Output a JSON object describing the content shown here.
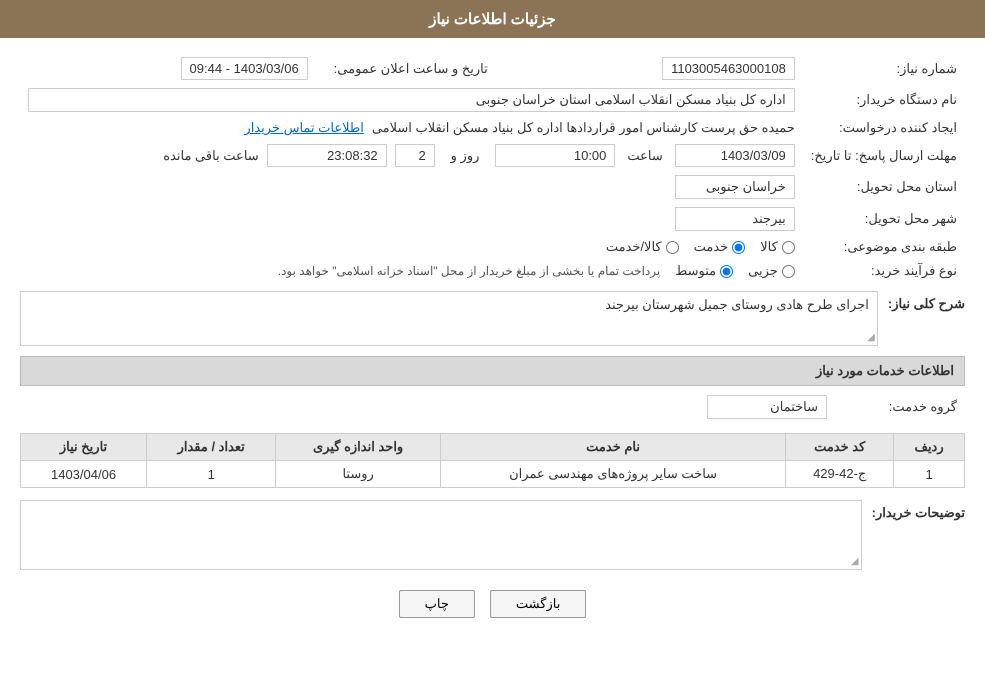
{
  "header": {
    "title": "جزئیات اطلاعات نیاز"
  },
  "fields": {
    "need_number_label": "شماره نیاز:",
    "need_number_value": "1103005463000108",
    "buyer_org_label": "نام دستگاه خریدار:",
    "buyer_org_value": "اداره کل بنیاد مسکن انقلاب اسلامی استان خراسان جنوبی",
    "creator_label": "ایجاد کننده درخواست:",
    "creator_value": "حمیده حق پرست کارشناس امور قراردادها اداره کل بنیاد مسکن انقلاب اسلامی",
    "creator_link": "اطلاعات تماس خریدار",
    "deadline_label": "مهلت ارسال پاسخ: تا تاریخ:",
    "date_announce_label": "تاریخ و ساعت اعلان عمومی:",
    "date_announce_value": "1403/03/06 - 09:44",
    "deadline_date": "1403/03/09",
    "deadline_time": "10:00",
    "deadline_days": "2",
    "deadline_time_remaining": "23:08:32",
    "province_label": "استان محل تحویل:",
    "province_value": "خراسان جنوبی",
    "city_label": "شهر محل تحویل:",
    "city_value": "بیرجند",
    "category_label": "طبقه بندی موضوعی:",
    "category_options": [
      {
        "id": "kala",
        "label": "کالا"
      },
      {
        "id": "khadamat",
        "label": "خدمت"
      },
      {
        "id": "kala_khadamat",
        "label": "کالا/خدمت"
      }
    ],
    "category_selected": "khadamat",
    "purchase_type_label": "نوع فرآیند خرید:",
    "purchase_type_options": [
      {
        "id": "jozii",
        "label": "جزیی"
      },
      {
        "id": "motavaset",
        "label": "متوسط"
      }
    ],
    "purchase_type_selected": "motavaset",
    "purchase_type_note": "پرداخت تمام یا بخشی از مبلغ خریدار از محل \"اسناد خزانه اسلامی\" خواهد بود.",
    "description_label": "شرح کلی نیاز:",
    "description_value": "اجرای طرح هادی روستای جمیل شهرستان بیرجند",
    "services_section_label": "اطلاعات خدمات مورد نیاز",
    "service_group_label": "گروه خدمت:",
    "service_group_value": "ساختمان",
    "services_table": {
      "columns": [
        "ردیف",
        "کد خدمت",
        "نام خدمت",
        "واحد اندازه گیری",
        "تعداد / مقدار",
        "تاریخ نیاز"
      ],
      "rows": [
        {
          "row": "1",
          "code": "ج-42-429",
          "name": "ساخت سایر پروژه‌های مهندسی عمران",
          "unit": "روستا",
          "quantity": "1",
          "date": "1403/04/06"
        }
      ]
    },
    "buyer_notes_label": "توضیحات خریدار:",
    "buyer_notes_value": "",
    "timer_label": "ساعت باقی مانده",
    "days_label": "روز و",
    "time_label": "ساعت"
  },
  "buttons": {
    "print_label": "چاپ",
    "back_label": "بازگشت"
  }
}
